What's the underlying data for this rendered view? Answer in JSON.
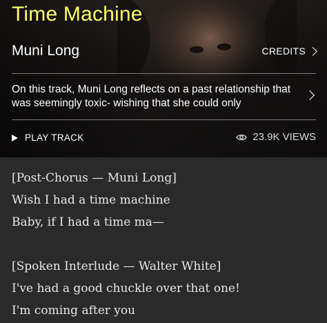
{
  "song": {
    "title": "Time Machine",
    "artist": "Muni Long",
    "credits_label": "CREDITS",
    "about": "On this track, Muni Long reflects on a past relationship that was seemingly toxic- wishing that she could only",
    "play_label": "PLAY TRACK",
    "views": "23.9K VIEWS"
  },
  "lyrics": {
    "block1": [
      "[Post-Chorus — Muni Long]",
      "Wish I had a time machine",
      "Baby, if I had a time ma—"
    ],
    "block2": [
      "[Spoken Interlude — Walter White]",
      "I've had a good chuckle over that one!",
      "I'm coming after you"
    ]
  },
  "colors": {
    "title": "#ffff64",
    "background": "#2a2a2a"
  }
}
